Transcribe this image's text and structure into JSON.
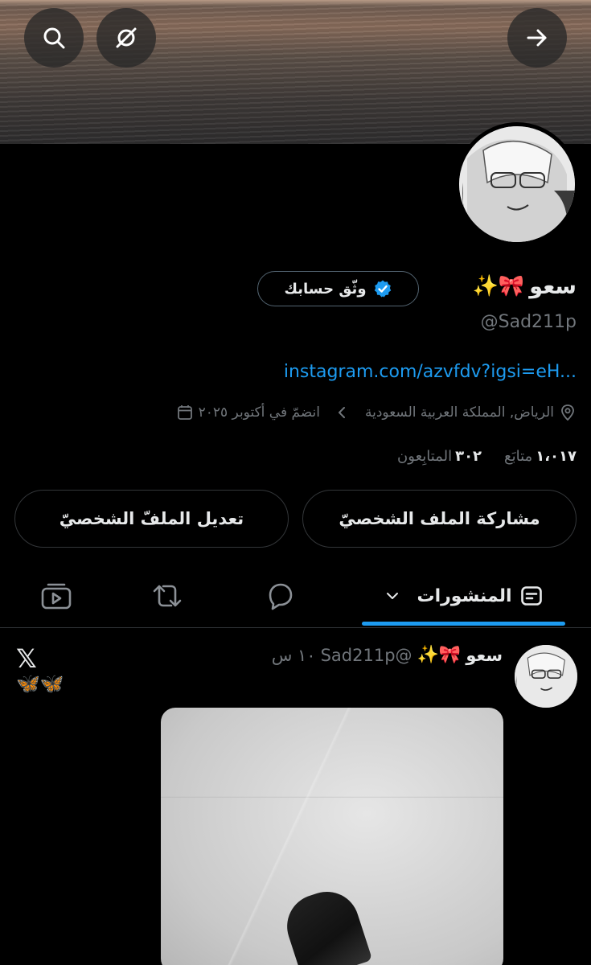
{
  "header": {
    "back_icon": "arrow-right-icon",
    "search_icon": "search-icon",
    "grok_icon": "slashed-circle-icon"
  },
  "profile": {
    "name": "سعو",
    "name_emojis": "🎀✨",
    "verify_button_label": "وثّق حسابك",
    "handle": "@Sad211p",
    "link": "instagram.com/azvfdv?igsi=eH...",
    "location": "الرياض, المملكة العربية السعودية",
    "joined": "انضمّ في أكتوبر ٢٠٢٥",
    "following_count": "١،٠١٧",
    "following_label": "متابَع",
    "followers_count": "٣٠٢",
    "followers_label": "المتابِعون",
    "share_button": "مشاركة الملف الشخصيّ",
    "edit_button": "تعديل الملفّ الشخصيّ"
  },
  "tabs": {
    "posts_label": "المنشورات",
    "items": [
      "posts",
      "replies",
      "reposts",
      "media"
    ]
  },
  "post": {
    "author_name": "سعو",
    "author_emojis": "🎀✨",
    "handle": "@Sad211p",
    "time": "١٠ س",
    "text": "🦋🦋",
    "badge": "𝕏"
  },
  "colors": {
    "accent": "#1d9bf0",
    "muted": "#71767b",
    "text": "#e7e9ea",
    "border": "#333639"
  }
}
